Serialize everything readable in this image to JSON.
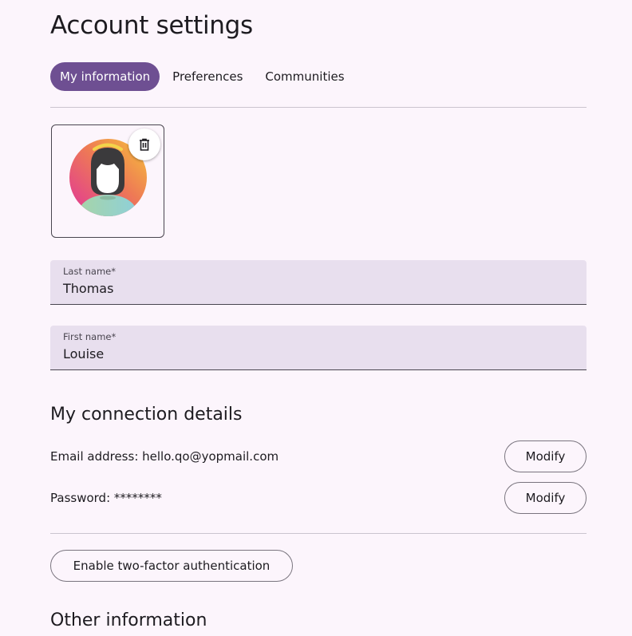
{
  "page": {
    "title": "Account settings"
  },
  "tabs": [
    {
      "label": "My information",
      "active": true
    },
    {
      "label": "Preferences",
      "active": false
    },
    {
      "label": "Communities",
      "active": false
    }
  ],
  "avatar": {
    "icon": "person-avatar",
    "delete_icon": "trash-icon"
  },
  "fields": {
    "last_name": {
      "label": "Last name*",
      "value": "Thomas"
    },
    "first_name": {
      "label": "First name*",
      "value": "Louise"
    }
  },
  "connection": {
    "title": "My connection details",
    "email_text": "Email address: hello.qo@yopmail.com",
    "password_text": "Password: ********",
    "modify_label": "Modify"
  },
  "two_factor": {
    "button_label": "Enable two-factor authentication"
  },
  "other": {
    "title": "Other information"
  },
  "colors": {
    "background": "#fcf5fc",
    "accent": "#6e4f92",
    "field_bg": "#e8dfee"
  }
}
